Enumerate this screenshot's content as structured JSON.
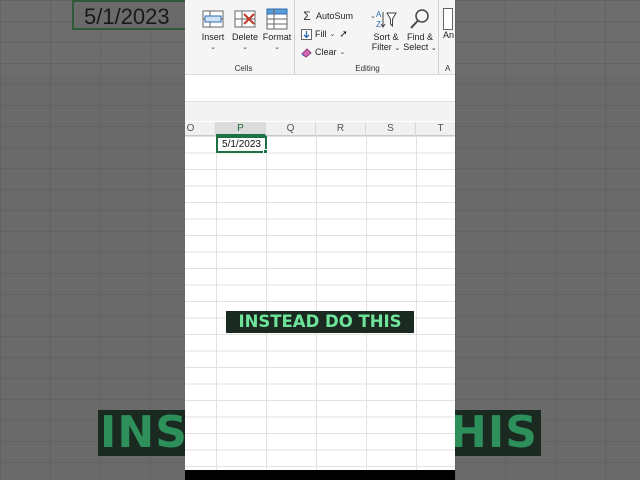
{
  "ribbon": {
    "cells_group": {
      "label": "Cells",
      "insert": "Insert",
      "delete": "Delete",
      "format": "Format"
    },
    "editing_group": {
      "label": "Editing",
      "autosum": "AutoSum",
      "fill": "Fill",
      "clear": "Clear",
      "sort_filter_line1": "Sort &",
      "sort_filter_line2": "Filter",
      "find_select_line1": "Find &",
      "find_select_line2": "Select"
    },
    "partial_next": "An",
    "partial_next_label": "A"
  },
  "columns": [
    "O",
    "P",
    "Q",
    "R",
    "S",
    "T"
  ],
  "selected_column": "P",
  "active_cell": {
    "value": "5/1/2023"
  },
  "caption": "INSTEAD DO THIS",
  "background": {
    "cell_value": "5/1/2023",
    "caption_left": "INS",
    "caption_right": "HIS"
  },
  "colors": {
    "accent": "#1e7145",
    "caption_text": "#6fe39a",
    "caption_bg": "#1b2a20"
  },
  "icons": [
    "insert-cells-icon",
    "delete-cells-icon",
    "format-cells-icon",
    "autosum-icon",
    "fill-icon",
    "clear-eraser-icon",
    "sort-filter-icon",
    "find-magnifier-icon",
    "mouse-cursor-icon"
  ]
}
